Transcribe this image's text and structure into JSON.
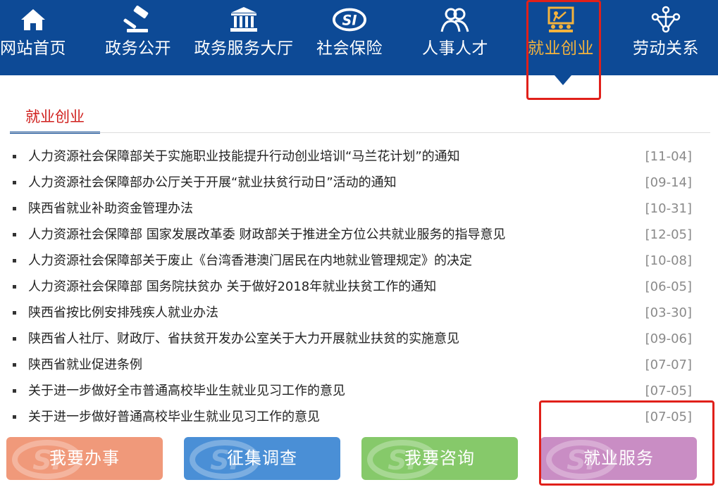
{
  "nav": {
    "items": [
      {
        "label": "网站首页",
        "icon": "home-icon",
        "active": false
      },
      {
        "label": "政务公开",
        "icon": "gavel-icon",
        "active": false
      },
      {
        "label": "政务服务大厅",
        "icon": "government-building-icon",
        "active": false
      },
      {
        "label": "社会保险",
        "icon": "si-logo-icon",
        "active": false
      },
      {
        "label": "人事人才",
        "icon": "people-icon",
        "active": false
      },
      {
        "label": "就业创业",
        "icon": "presentation-icon",
        "active": true
      },
      {
        "label": "劳动关系",
        "icon": "network-icon",
        "active": false
      }
    ]
  },
  "section": {
    "title": "就业创业"
  },
  "news": [
    {
      "title": "人力资源社会保障部关于实施职业技能提升行动创业培训“马兰花计划”的通知",
      "date": "[11-04]"
    },
    {
      "title": "人力资源社会保障部办公厅关于开展“就业扶贫行动日”活动的通知",
      "date": "[09-14]"
    },
    {
      "title": "陕西省就业补助资金管理办法",
      "date": "[10-31]"
    },
    {
      "title": "人力资源社会保障部 国家发展改革委 财政部关于推进全方位公共就业服务的指导意见",
      "date": "[12-05]"
    },
    {
      "title": "人力资源社会保障部关于废止《台湾香港澳门居民在内地就业管理规定》的决定",
      "date": "[10-08]"
    },
    {
      "title": "人力资源社会保障部 国务院扶贫办 关于做好2018年就业扶贫工作的通知",
      "date": "[06-05]"
    },
    {
      "title": "陕西省按比例安排残疾人就业办法",
      "date": "[03-30]"
    },
    {
      "title": "陕西省人社厅、财政厅、省扶贫开发办公室关于大力开展就业扶贫的实施意见",
      "date": "[09-06]"
    },
    {
      "title": "陕西省就业促进条例",
      "date": "[07-07]"
    },
    {
      "title": "关于进一步做好全市普通高校毕业生就业见习工作的意见",
      "date": "[07-05]"
    },
    {
      "title": "关于进一步做好普通高校毕业生就业见习工作的意见",
      "date": "[07-05]"
    }
  ],
  "buttons": [
    {
      "label": "我要办事",
      "color": "#f0997a"
    },
    {
      "label": "征集调查",
      "color": "#4a8fd6"
    },
    {
      "label": "我要咨询",
      "color": "#86c96a"
    },
    {
      "label": "就业服务",
      "color": "#c98dc4"
    }
  ],
  "colors": {
    "nav_bg": "#0d4a96",
    "active": "#f3b33d",
    "section_title": "#d0201d",
    "highlight": "#e0201a"
  }
}
